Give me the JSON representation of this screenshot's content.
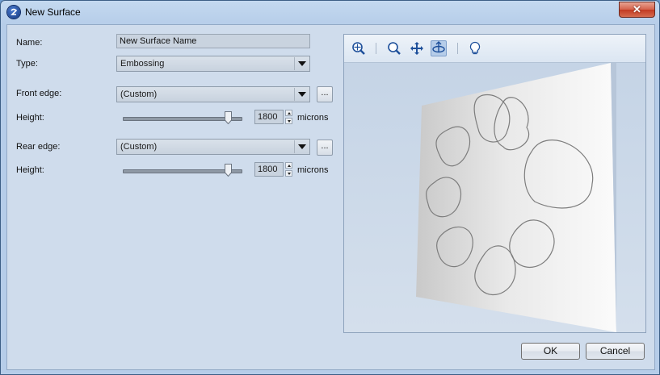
{
  "window": {
    "title": "New Surface",
    "close_glyph": "✕"
  },
  "form": {
    "name_label": "Name:",
    "name_value": "New Surface Name",
    "type_label": "Type:",
    "type_value": "Embossing",
    "front_edge_label": "Front edge:",
    "front_edge_value": "(Custom)",
    "front_edge_more": "...",
    "front_height_label": "Height:",
    "front_height_value": "1800",
    "front_height_unit": "microns",
    "rear_edge_label": "Rear edge:",
    "rear_edge_value": "(Custom)",
    "rear_edge_more": "...",
    "rear_height_label": "Height:",
    "rear_height_value": "1800",
    "rear_height_unit": "microns"
  },
  "viewer": {
    "tools": [
      "zoom-extents-icon",
      "zoom-icon",
      "pan-icon",
      "rotate-icon",
      "light-bulb-icon"
    ],
    "active_tool": "rotate-icon"
  },
  "buttons": {
    "ok": "OK",
    "cancel": "Cancel"
  },
  "colors": {
    "accent": "#2f6fb8",
    "window_frame": "#b6cde9",
    "client_bg": "#cfdcec"
  }
}
